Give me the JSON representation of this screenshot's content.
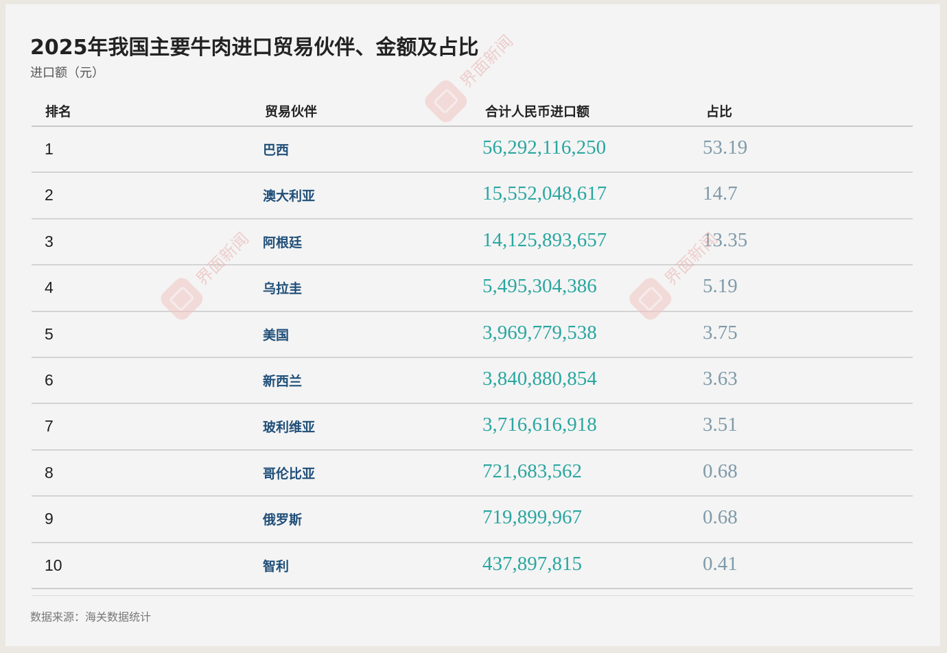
{
  "title": "2025年我国主要牛肉进口贸易伙伴、金额及占比",
  "subtitle": "进口额（元）",
  "chart_data": {
    "type": "table",
    "columns": [
      "排名",
      "贸易伙伴",
      "合计人民币进口额",
      "占比"
    ],
    "rows": [
      {
        "rank": "1",
        "partner": "巴西",
        "amount": "56,292,116,250",
        "share": "53.19"
      },
      {
        "rank": "2",
        "partner": "澳大利亚",
        "amount": "15,552,048,617",
        "share": "14.7"
      },
      {
        "rank": "3",
        "partner": "阿根廷",
        "amount": "14,125,893,657",
        "share": "13.35"
      },
      {
        "rank": "4",
        "partner": "乌拉圭",
        "amount": "5,495,304,386",
        "share": "5.19"
      },
      {
        "rank": "5",
        "partner": "美国",
        "amount": "3,969,779,538",
        "share": "3.75"
      },
      {
        "rank": "6",
        "partner": "新西兰",
        "amount": "3,840,880,854",
        "share": "3.63"
      },
      {
        "rank": "7",
        "partner": "玻利维亚",
        "amount": "3,716,616,918",
        "share": "3.51"
      },
      {
        "rank": "8",
        "partner": "哥伦比亚",
        "amount": "721,683,562",
        "share": "0.68"
      },
      {
        "rank": "9",
        "partner": "俄罗斯",
        "amount": "719,899,967",
        "share": "0.68"
      },
      {
        "rank": "10",
        "partner": "智利",
        "amount": "437,897,815",
        "share": "0.41"
      }
    ]
  },
  "source": "数据来源：海关数据统计",
  "watermark_text": "界面新闻",
  "colors": {
    "amount": "#2aa6a0",
    "share": "#7f9aa9",
    "partner": "#1f4e78",
    "watermark": "#e8b0ac"
  }
}
